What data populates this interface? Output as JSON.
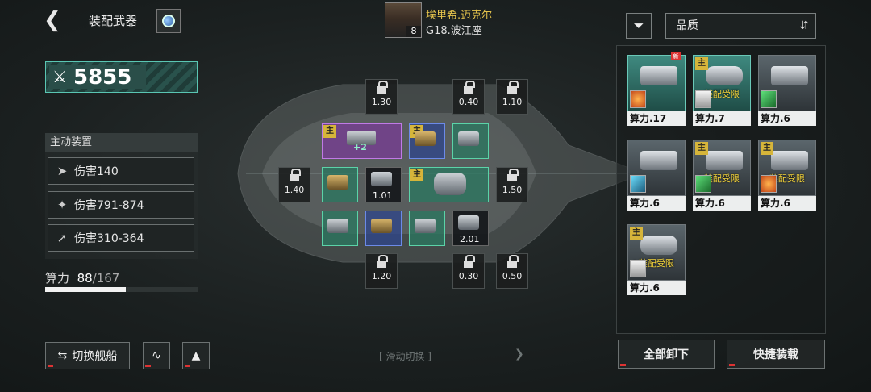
{
  "header": {
    "back_icon": "chevron-left-icon",
    "title": "装配武器",
    "planet_icon": "planet-icon"
  },
  "captain": {
    "name": "埃里希.迈克尔",
    "level": "8",
    "ship": "G18.波江座"
  },
  "power": {
    "value": "5855"
  },
  "devices": {
    "heading": "主动装置",
    "rows": [
      {
        "label": "伤害140",
        "icon": "cannon-icon"
      },
      {
        "label": "伤害791-874",
        "icon": "claw-icon"
      },
      {
        "label": "伤害310-364",
        "icon": "missile-icon"
      }
    ]
  },
  "compute": {
    "label": "算力",
    "used": "88",
    "total": "/167",
    "fraction": 0.527
  },
  "buttons": {
    "swap_ship": "切换舰船",
    "unload_all": "全部卸下",
    "quick_equip": "快捷装载"
  },
  "swipe_hint": "[ 滑动切换 ]",
  "slots": {
    "locks": [
      "1.30",
      "0.40",
      "1.10",
      "1.40",
      "1.50",
      "1.20",
      "0.30",
      "0.50"
    ],
    "badge": "主",
    "plus": "+2",
    "values": [
      "1.01",
      "2.01"
    ]
  },
  "filter": {
    "sort_label": "品质"
  },
  "inventory": {
    "cards": [
      {
        "caption": "算力.17",
        "badge": "",
        "warning": "",
        "new": "新"
      },
      {
        "caption": "算力.7",
        "badge": "主",
        "warning": "装配受限",
        "new": ""
      },
      {
        "caption": "算力.6",
        "badge": "",
        "warning": "",
        "new": ""
      },
      {
        "caption": "算力.6",
        "badge": "",
        "warning": "",
        "new": ""
      },
      {
        "caption": "算力.6",
        "badge": "主",
        "warning": "装配受限",
        "new": ""
      },
      {
        "caption": "算力.6",
        "badge": "主",
        "warning": "装配受限",
        "new": ""
      },
      {
        "caption": "算力.6",
        "badge": "主",
        "warning": "装配受限",
        "new": ""
      }
    ]
  }
}
